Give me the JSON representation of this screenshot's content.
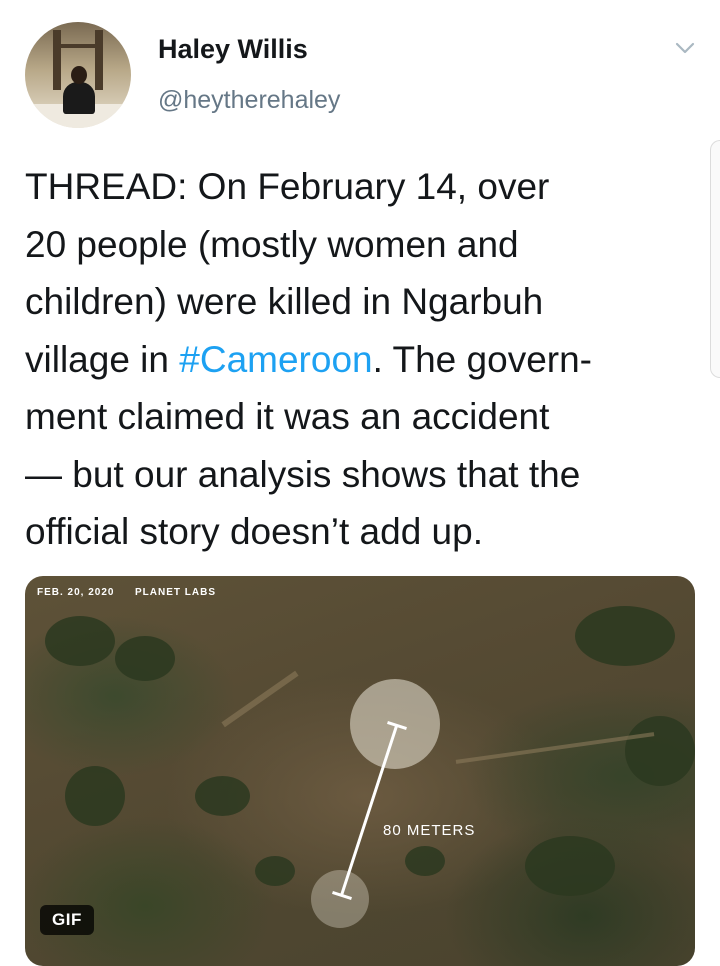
{
  "tweet": {
    "author": {
      "display_name": "Haley Willis",
      "handle": "@heytherehaley"
    },
    "menu_icon": "chevron-down-icon",
    "text_lines": [
      {
        "before": "THREAD: On February 14, over",
        "hashtag": "",
        "after": ""
      },
      {
        "before": "20 people (mostly women and",
        "hashtag": "",
        "after": ""
      },
      {
        "before": "children) were killed in Ngarbuh",
        "hashtag": "",
        "after": ""
      },
      {
        "before": "village in ",
        "hashtag": "#Cameroon",
        "after": ". The govern-"
      },
      {
        "before": "ment claimed it was an accident",
        "hashtag": "",
        "after": ""
      },
      {
        "before": "— but our analysis shows that the",
        "hashtag": "",
        "after": ""
      },
      {
        "before": "official story doesn’t add up.",
        "hashtag": "",
        "after": ""
      }
    ],
    "media": {
      "caption_date": "FEB. 20, 2020",
      "caption_source": "PLANET LABS",
      "measure_label": "80 METERS",
      "badge": "GIF"
    }
  },
  "colors": {
    "text": "#14171a",
    "secondary": "#657786",
    "link": "#1da1f2"
  }
}
